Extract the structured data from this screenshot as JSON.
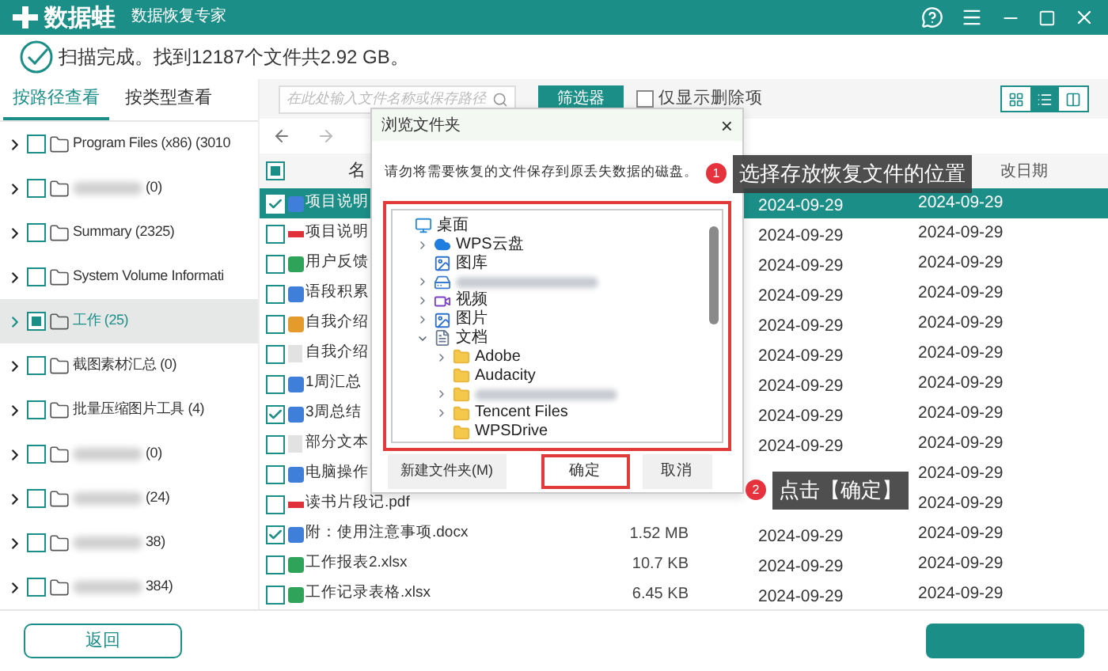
{
  "app": {
    "logo": "数据蛙",
    "subtitle": "数据恢复专家"
  },
  "status": "扫描完成。找到12187个文件共2.92 GB。",
  "view_tabs": [
    {
      "label": "按路径查看",
      "selected": true
    },
    {
      "label": "按类型查看",
      "selected": false
    }
  ],
  "tree": [
    {
      "label": "Program Files (x86) (3010",
      "blurred": false,
      "partial": false,
      "selected": false
    },
    {
      "label": "(0)",
      "blurred": true,
      "partial": false,
      "selected": false
    },
    {
      "label": "Summary (2325)",
      "blurred": false,
      "partial": false,
      "selected": false
    },
    {
      "label": "System Volume Informati",
      "blurred": false,
      "partial": false,
      "selected": false
    },
    {
      "label": "工作 (25)",
      "blurred": false,
      "partial": true,
      "selected": true
    },
    {
      "label": "截图素材汇总 (0)",
      "blurred": false,
      "partial": false,
      "selected": false
    },
    {
      "label": "批量压缩图片工具 (4)",
      "blurred": false,
      "partial": false,
      "selected": false
    },
    {
      "label": "(0)",
      "blurred": true,
      "partial": false,
      "selected": false
    },
    {
      "label": "(24)",
      "blurred": true,
      "partial": false,
      "selected": false
    },
    {
      "label": "38)",
      "blurred": true,
      "partial": false,
      "selected": false
    },
    {
      "label": "384)",
      "blurred": true,
      "partial": false,
      "selected": false
    }
  ],
  "back_button": "返回",
  "search": {
    "placeholder": "在此处输入文件名称或保存路径"
  },
  "filter_button": "筛选器",
  "deleted_only": {
    "label": "仅显示删除项",
    "checked": false
  },
  "view_buttons": [
    {
      "kind": "grid",
      "selected": false
    },
    {
      "kind": "list",
      "selected": true
    },
    {
      "kind": "columns",
      "selected": false
    }
  ],
  "file_header": {
    "partial": true,
    "name": "名",
    "column_date2": "改日期"
  },
  "files": [
    {
      "kind": "word",
      "name": "项目说明",
      "checked": true,
      "selected": true,
      "date1": "2024-09-29",
      "date2": "2024-09-29"
    },
    {
      "kind": "pdf",
      "name": "项目说明",
      "checked": false,
      "selected": false,
      "date1": "2024-09-29",
      "date2": "2024-09-29"
    },
    {
      "kind": "excel",
      "name": "用户反馈",
      "checked": false,
      "selected": false,
      "date1": "2024-09-29",
      "date2": "2024-09-29"
    },
    {
      "kind": "word",
      "name": "语段积累",
      "checked": false,
      "selected": false,
      "date1": "2024-09-29",
      "date2": "2024-09-29"
    },
    {
      "kind": "ppt",
      "name": "自我介绍",
      "checked": false,
      "selected": false,
      "date1": "2024-09-29",
      "date2": "2024-09-29"
    },
    {
      "kind": "text",
      "name": "自我介绍",
      "checked": false,
      "selected": false,
      "date1": "2024-09-29",
      "date2": "2024-09-29"
    },
    {
      "kind": "word",
      "name": "1周汇总",
      "checked": false,
      "selected": false,
      "date1": "2024-09-29",
      "date2": "2024-09-29"
    },
    {
      "kind": "word",
      "name": "3周总结",
      "checked": true,
      "selected": false,
      "date1": "2024-09-29",
      "date2": "2024-09-29"
    },
    {
      "kind": "text",
      "name": "部分文本",
      "checked": false,
      "selected": false,
      "date1": "2024-09-29",
      "date2": "2024-09-29"
    },
    {
      "kind": "word",
      "name": "电脑操作",
      "checked": false,
      "selected": false,
      "date2": "2024-09-29"
    },
    {
      "kind": "pdf",
      "name": "读书片段记.pdf",
      "checked": false,
      "selected": false,
      "date2": "2024-09-29"
    },
    {
      "kind": "word",
      "name": "附：使用注意事项.docx",
      "checked": true,
      "selected": false,
      "size": "1.52 MB",
      "date1": "2024-09-29",
      "date2": "2024-09-29"
    },
    {
      "kind": "excel",
      "name": "工作报表2.xlsx",
      "checked": false,
      "selected": false,
      "size": "10.7 KB",
      "date1": "2024-09-29",
      "date2": "2024-09-29"
    },
    {
      "kind": "excel",
      "name": "工作记录表格.xlsx",
      "checked": false,
      "selected": false,
      "size": "6.45 KB",
      "date1": "2024-09-29",
      "date2": "2024-09-29"
    }
  ],
  "dialog": {
    "title": "浏览文件夹",
    "close": "×",
    "message": "请勿将需要恢复的文件保存到原丢失数据的磁盘。",
    "folders": [
      {
        "label": "桌面",
        "kind": "desktop",
        "children": [
          {
            "label": "WPS云盘",
            "kind": "cloud",
            "expanded": false
          },
          {
            "label": "图库",
            "kind": "gallery"
          },
          {
            "blurred": true,
            "kind": "drive",
            "expanded": false
          },
          {
            "label": "视频",
            "kind": "video",
            "expanded": false
          },
          {
            "label": "图片",
            "kind": "gallery",
            "expanded": false
          },
          {
            "label": "文档",
            "kind": "document",
            "expanded": true,
            "children": [
              {
                "label": "Adobe",
                "kind": "folder",
                "expanded": false
              },
              {
                "label": "Audacity",
                "kind": "folder"
              },
              {
                "blurred": true,
                "kind": "folder",
                "expanded": false
              },
              {
                "label": "Tencent Files",
                "kind": "folder",
                "expanded": false
              },
              {
                "label": "WPSDrive",
                "kind": "folder"
              }
            ]
          }
        ]
      }
    ],
    "new_folder_button": "新建文件夹(M)",
    "ok_button": "确定",
    "cancel_button": "取消"
  },
  "callouts": [
    {
      "number": "1",
      "text": "选择存放恢复文件的位置"
    },
    {
      "number": "2",
      "text": "点击【确定】"
    }
  ]
}
